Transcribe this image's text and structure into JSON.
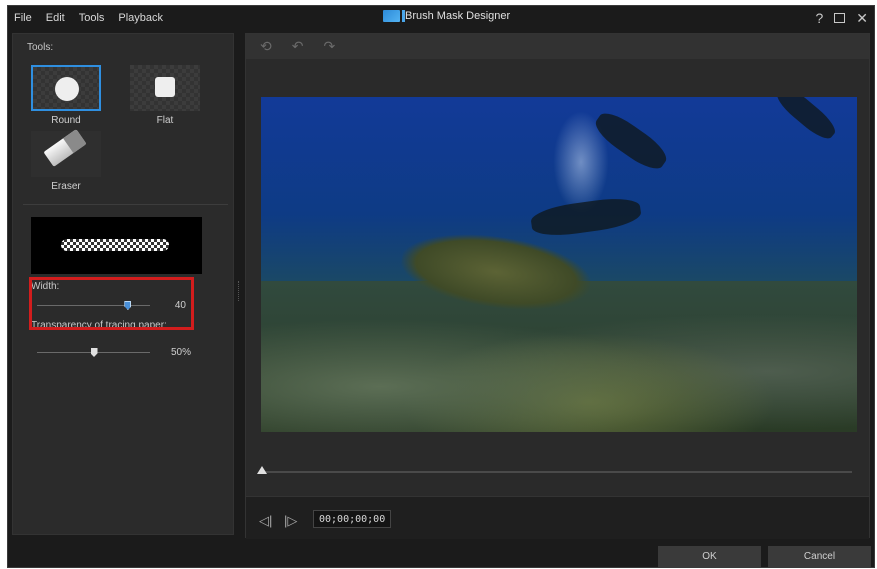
{
  "menu": [
    "File",
    "Edit",
    "Tools",
    "Playback"
  ],
  "window": {
    "title": "Brush Mask Designer",
    "help": "?",
    "close": "✕"
  },
  "left_panel": {
    "tools_label": "Tools:",
    "tools": [
      {
        "label": "Round",
        "selected": true
      },
      {
        "label": "Flat",
        "selected": false
      },
      {
        "label": "Eraser",
        "selected": false
      }
    ],
    "width": {
      "label": "Width:",
      "value": "40",
      "level": 0.8
    },
    "transparency": {
      "label": "Transparency of tracing paper:",
      "value": "50%",
      "level": 0.5
    }
  },
  "toolbar": {
    "icons": [
      "reset-icon",
      "undo-icon",
      "redo-icon"
    ]
  },
  "timeline": {
    "position": 0,
    "timecode": "00;00;00;00"
  },
  "playback": {
    "prev_icon": "prev-frame-icon",
    "next_icon": "next-frame-icon"
  },
  "buttons": {
    "ok": "OK",
    "cancel": "Cancel"
  },
  "colors": {
    "selection": "#2f8fe0",
    "highlight": "#d21d1d",
    "background": "#1b1b1b"
  }
}
